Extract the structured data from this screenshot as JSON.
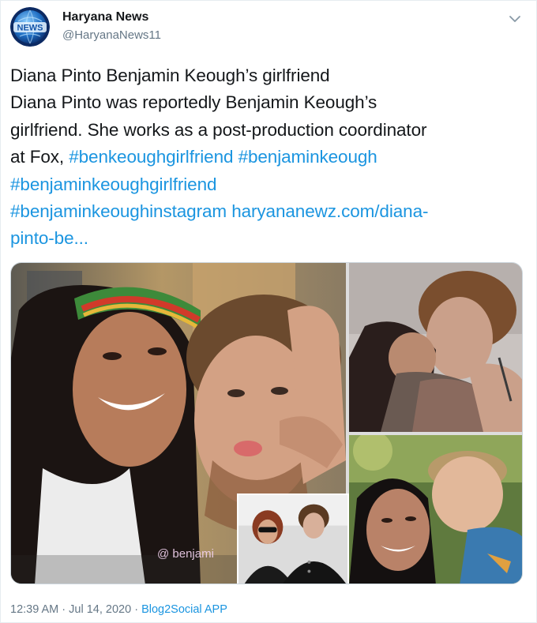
{
  "author": {
    "name": "Haryana News",
    "handle": "@HaryanaNews11",
    "avatar_icon": "globe-news-logo",
    "avatar_logo_text": "NEWS"
  },
  "menu_icon": "chevron-down-icon",
  "tweet": {
    "lines": [
      [
        {
          "t": "Diana Pinto Benjamin Keough’s girlfriend"
        }
      ],
      [
        {
          "t": "Diana Pinto was reportedly  Benjamin Keough’s"
        }
      ],
      [
        {
          "t": "girlfriend. She works as a post-production coordinator"
        }
      ],
      [
        {
          "t": "at Fox,  "
        },
        {
          "t": "#benkeoughgirlfriend",
          "link": true
        },
        {
          "t": " "
        },
        {
          "t": "#benjaminkeough",
          "link": true
        }
      ],
      [
        {
          "t": "#benjaminkeoughgirlfriend",
          "link": true
        }
      ],
      [
        {
          "t": "#benjaminkeoughinstagram",
          "link": true
        },
        {
          "t": " "
        },
        {
          "t": "haryananewz.com/diana-",
          "link": true
        }
      ],
      [
        {
          "t": "pinto-be...",
          "link": true
        }
      ]
    ]
  },
  "media": {
    "watermark": "@ benjami",
    "photos": [
      "photo-main-selfie",
      "photo-kiss",
      "photo-inset-couple",
      "photo-selfie-outdoor"
    ]
  },
  "footer": {
    "time": "12:39 AM",
    "sep1": " · ",
    "date": "Jul 14, 2020",
    "sep2": " · ",
    "source": "Blog2Social APP"
  },
  "colors": {
    "link": "#1b95e0",
    "secondary_text": "#657786",
    "primary_text": "#14171a"
  }
}
